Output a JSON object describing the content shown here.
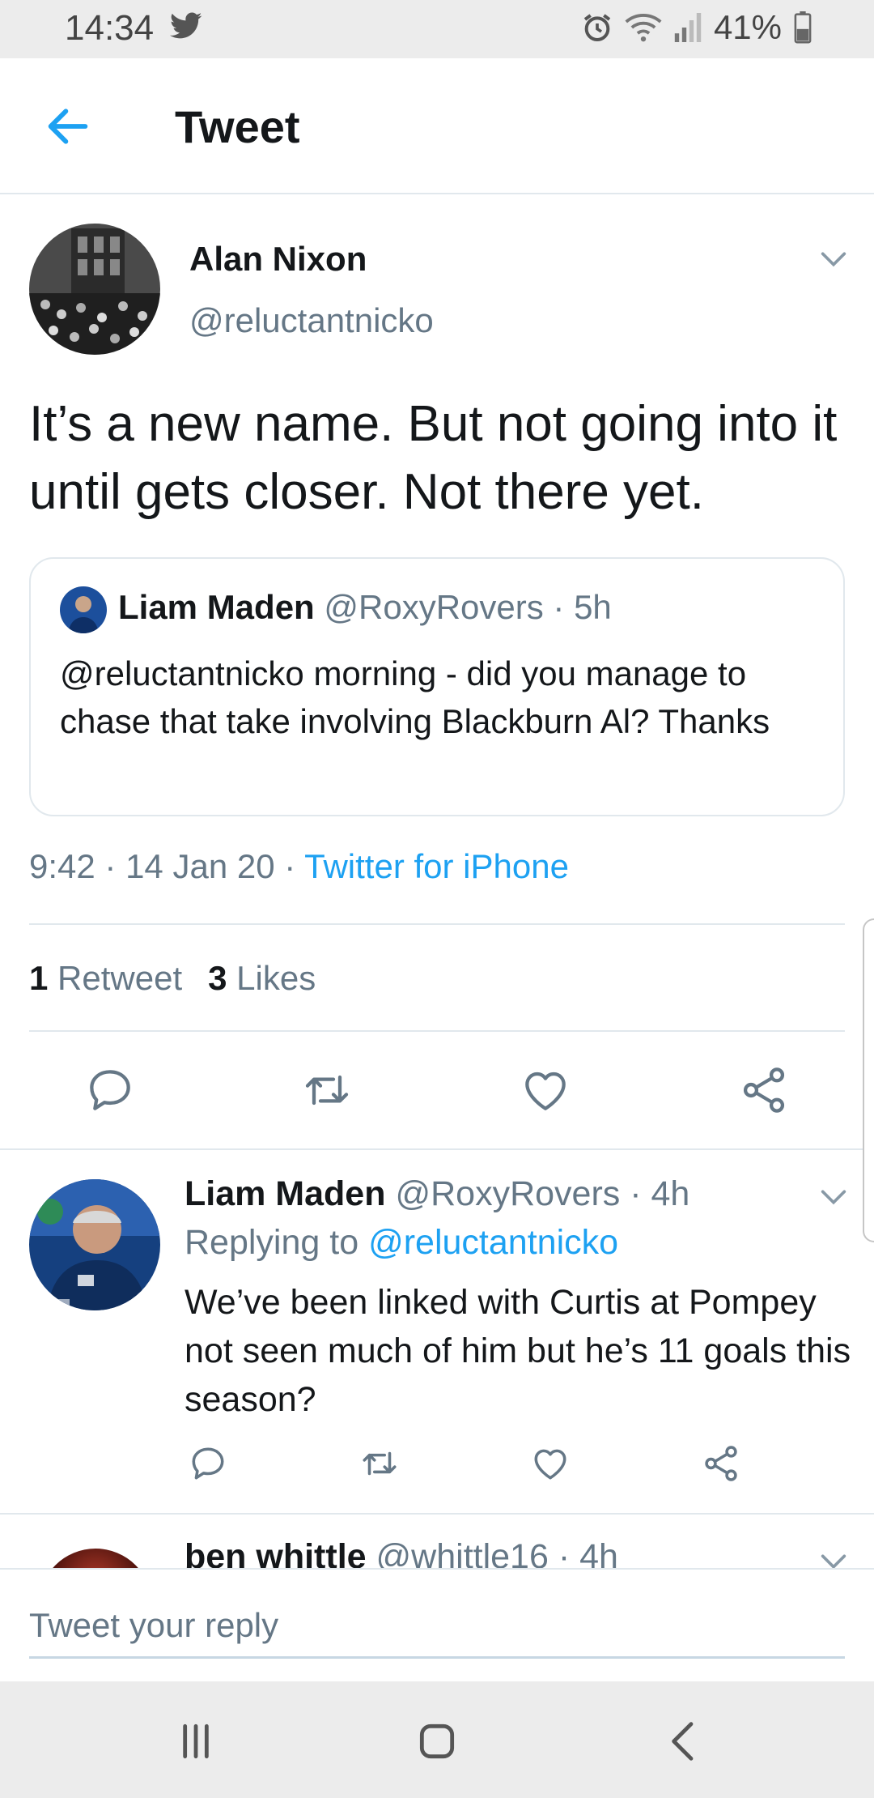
{
  "status_bar": {
    "time": "14:34",
    "battery": "41%",
    "icons": [
      "twitter-icon",
      "alarm-icon",
      "wifi-icon",
      "signal-icon",
      "battery-icon"
    ]
  },
  "header": {
    "title": "Tweet",
    "back_icon": "arrow-left-icon"
  },
  "tweet": {
    "author_name": "Alan Nixon",
    "author_handle": "@reluctantnicko",
    "text": "It’s a new name. But not going into it until gets closer. Not there yet.",
    "quoted": {
      "name": "Liam Maden",
      "meta": "@RoxyRovers · 5h",
      "text": "@reluctantnicko morning - did you manage to chase that take involving Blackburn Al? Thanks"
    },
    "time_date": "9:42 · 14 Jan 20 · ",
    "source": "Twitter for iPhone",
    "retweet_count": "1",
    "retweet_label": "Retweet",
    "like_count": "3",
    "like_label": "Likes"
  },
  "replies": [
    {
      "name": "Liam Maden",
      "meta": "@RoxyRovers · 4h",
      "replying_prefix": "Replying to ",
      "replying_to": "@reluctantnicko",
      "text": "We’ve been linked with Curtis at Pompey not seen much of him but he’s 11 goals this season?"
    },
    {
      "name": "ben whittle",
      "meta": "@whittle16 · 4h"
    }
  ],
  "reply_box": {
    "placeholder": "Tweet your reply"
  },
  "colors": {
    "accent": "#1da1f2",
    "text_primary": "#14171a",
    "text_secondary": "#657786",
    "divider": "#e1e8ed"
  }
}
